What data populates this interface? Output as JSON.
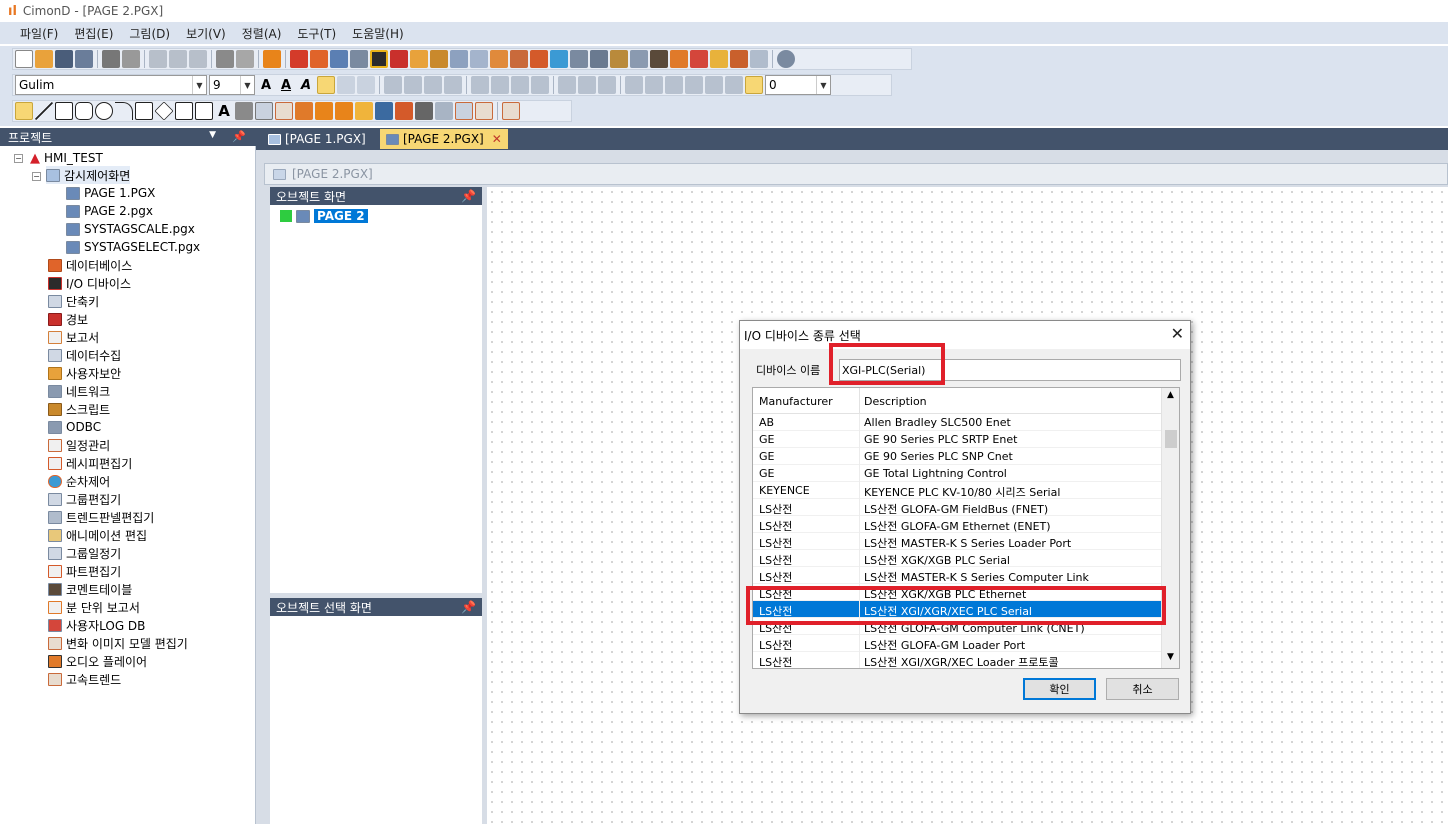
{
  "app": {
    "title": "CimonD - [PAGE 2.PGX]"
  },
  "menu": [
    "파일(F)",
    "편집(E)",
    "그림(D)",
    "보기(V)",
    "정렬(A)",
    "도구(T)",
    "도움말(H)"
  ],
  "toolbar": {
    "font_name": "Gulim",
    "font_size": "9",
    "line_width": "0"
  },
  "project": {
    "header": "프로젝트",
    "root": "HMI_TEST",
    "group": "감시제어화면",
    "pages": [
      "PAGE 1.PGX",
      "PAGE 2.pgx",
      "SYSTAGSCALE.pgx",
      "SYSTAGSELECT.pgx"
    ],
    "items": [
      "데이터베이스",
      "I/O 디바이스",
      "단축키",
      "경보",
      "보고서",
      "데이터수집",
      "사용자보안",
      "네트워크",
      "스크립트",
      "ODBC",
      "일정관리",
      "레시피편집기",
      "순차제어",
      "그룹편집기",
      "트렌드판넬편집기",
      "애니메이션 편집",
      "그룹일정기",
      "파트편집기",
      "코멘트테이블",
      "분 단위 보고서",
      "사용자LOG DB",
      "변화 이미지 모델 편집기",
      "오디오 플레이어",
      "고속트렌드"
    ]
  },
  "tabs": [
    {
      "label": "[PAGE 1.PGX]"
    },
    {
      "label": "[PAGE 2.PGX]"
    }
  ],
  "doc": {
    "inner_title": "[PAGE 2.PGX]"
  },
  "object_panel": {
    "title": "오브젝트 화면",
    "page": "PAGE 2",
    "select_title": "오브젝트 선택 화면"
  },
  "dialog": {
    "title": "I/O 디바이스 종류 선택",
    "name_label": "디바이스 이름",
    "name_value": "XGI-PLC(Serial)",
    "col_manufacturer": "Manufacturer",
    "col_description": "Description",
    "rows": [
      {
        "m": "AB",
        "d": "Allen Bradley SLC500 Enet"
      },
      {
        "m": "GE",
        "d": "GE 90 Series PLC SRTP Enet"
      },
      {
        "m": "GE",
        "d": "GE 90 Series PLC SNP Cnet"
      },
      {
        "m": "GE",
        "d": "GE Total Lightning Control"
      },
      {
        "m": "KEYENCE",
        "d": "KEYENCE PLC KV-10/80 시리즈 Serial"
      },
      {
        "m": "LS산전",
        "d": "LS산전 GLOFA-GM FieldBus (FNET)"
      },
      {
        "m": "LS산전",
        "d": "LS산전 GLOFA-GM Ethernet (ENET)"
      },
      {
        "m": "LS산전",
        "d": "LS산전 MASTER-K S Series Loader Port"
      },
      {
        "m": "LS산전",
        "d": "LS산전 XGK/XGB PLC Serial"
      },
      {
        "m": "LS산전",
        "d": "LS산전 MASTER-K S Series Computer Link"
      },
      {
        "m": "LS산전",
        "d": "LS산전 XGK/XGB PLC Ethernet"
      },
      {
        "m": "LS산전",
        "d": "LS산전 XGI/XGR/XEC PLC Serial"
      },
      {
        "m": "LS산전",
        "d": "LS산전 GLOFA-GM Computer Link (CNET)"
      },
      {
        "m": "LS산전",
        "d": "LS산전 GLOFA-GM Loader Port"
      },
      {
        "m": "LS산전",
        "d": "LS산전 XGI/XGR/XEC Loader 프로토콜"
      }
    ],
    "selected_index": 11,
    "ok": "확인",
    "cancel": "취소"
  },
  "colors": {
    "accent": "#0078d7",
    "highlight": "#e0202a",
    "panel_header": "#43536b",
    "toolbar_bg": "#dbe3ef"
  }
}
